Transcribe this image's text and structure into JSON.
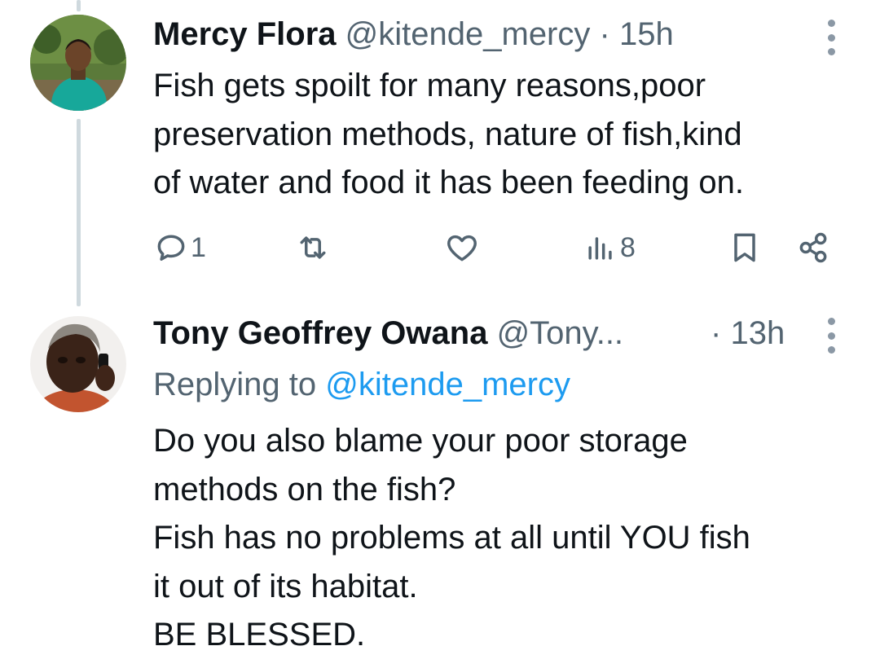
{
  "tweets": [
    {
      "name": "Mercy Flora",
      "handle": "@kitende_mercy",
      "separator": "·",
      "time": "15h",
      "text_lines": [
        "Fish gets spoilt for many reasons,poor",
        "preservation methods, nature of fish,kind",
        "of water and food it has been feeding on."
      ],
      "actions": {
        "reply_count": "1",
        "retweet_count": "",
        "like_count": "",
        "views_count": "8"
      },
      "icons": {
        "reply": "reply-icon",
        "retweet": "retweet-icon",
        "like": "heart-icon",
        "views": "views-icon",
        "bookmark": "bookmark-icon",
        "share": "share-icon",
        "more": "more-options-icon"
      }
    },
    {
      "name": "Tony Geoffrey Owana",
      "handle": "@Tony...",
      "separator": "·",
      "time": "13h",
      "reply_prefix": "Replying to",
      "reply_mention": "@kitende_mercy",
      "text_lines": [
        "Do you also blame your poor storage",
        "methods on the fish?",
        "Fish has no problems at all until YOU fish",
        "it out of its habitat.",
        "BE BLESSED."
      ]
    }
  ],
  "colors": {
    "text": "#0f1419",
    "secondary": "#536471",
    "accent": "#1d9bf0",
    "thread_line": "#cfd9de"
  }
}
